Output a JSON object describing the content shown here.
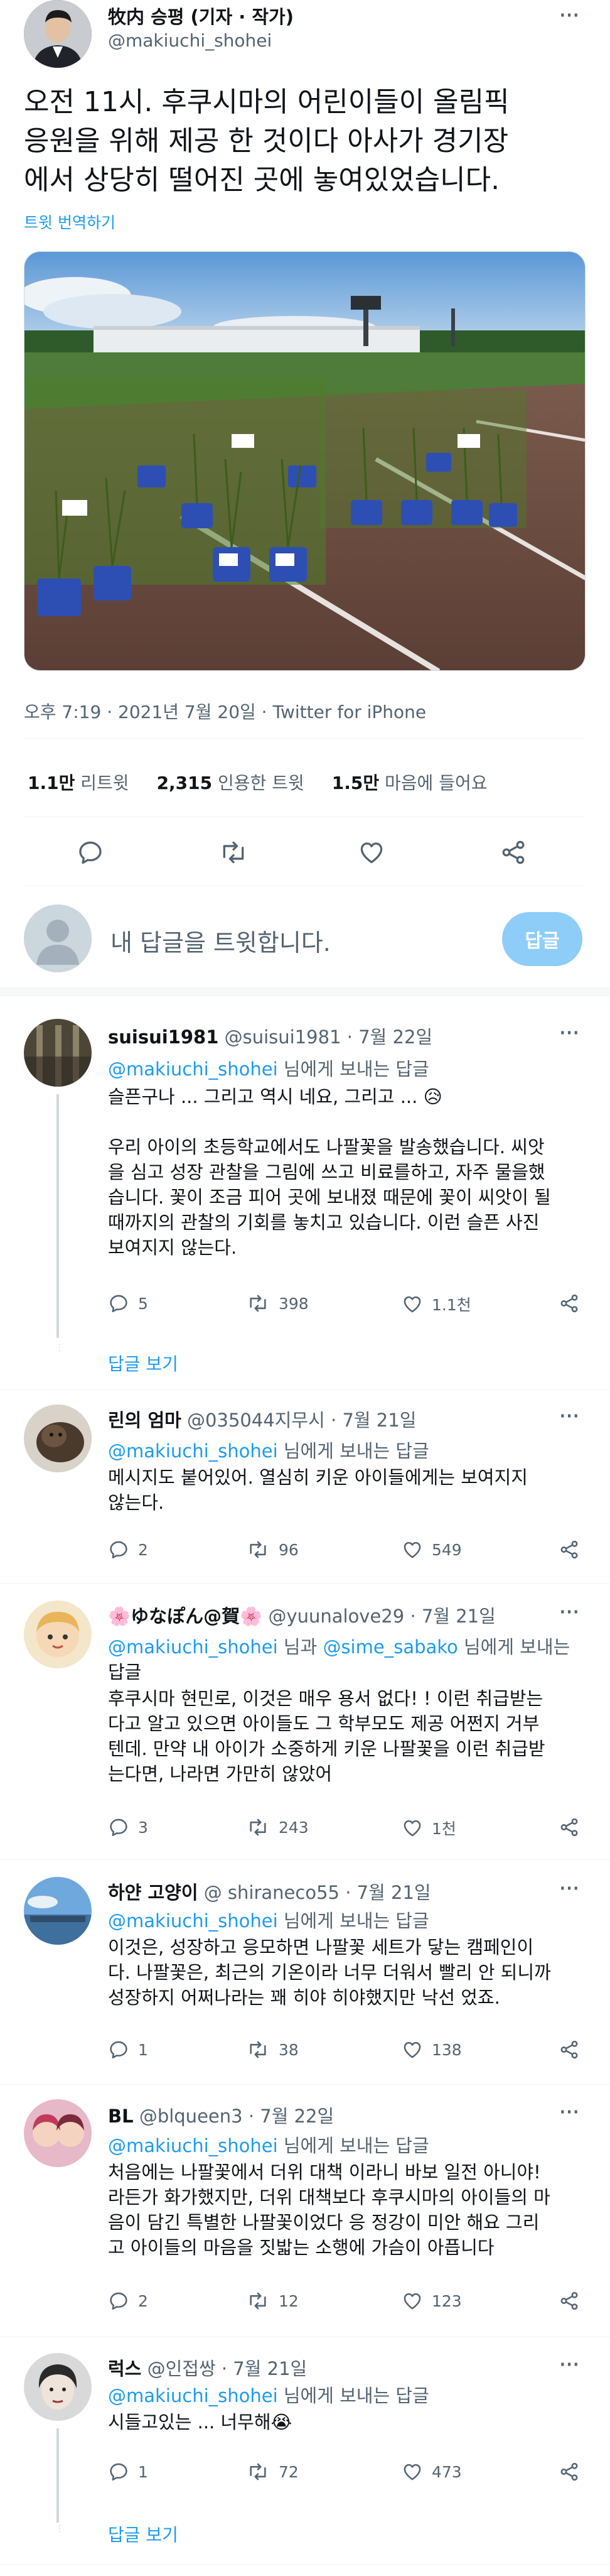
{
  "main_tweet": {
    "author_name": "牧内 승평 (기자 · 작가)",
    "author_handle": "@makiuchi_shohei",
    "text_lines": [
      "오전 11시. 후쿠시마의 어린이들이 올림픽",
      "응원을 위해 제공 한 것이다 아사가 경기장",
      "에서 상당히 떨어진 곳에 놓여있었습니다."
    ],
    "translate_label": "트윗 번역하기",
    "timestamp": "오후 7:19 · 2021년 7월 20일 · Twitter for iPhone",
    "stats": [
      {
        "value": "1.1만",
        "label": "리트윗"
      },
      {
        "value": "2,315",
        "label": "인용한 트윗"
      },
      {
        "value": "1.5만",
        "label": "마음에 들어요"
      }
    ]
  },
  "compose": {
    "placeholder": "내 답글을 트윗합니다.",
    "reply_button": "답글"
  },
  "replies": [
    {
      "name": "suisui1981",
      "handle": "@suisui1981",
      "date": "· 7월 22일",
      "reply_to_handle": "@makiuchi_shohei",
      "reply_to_suffix": " 님에게 보내는 답글",
      "first_line": "슬픈구나 ... 그리고 역시 네요, 그리고 ... 😥",
      "body_lines": [
        "우리 아이의 초등학교에서도 나팔꽃을 발송했습니다. 씨앗",
        "을 심고 성장 관찰을 그림에 쓰고 비료를하고, 자주 물을했",
        "습니다. 꽃이 조금 피어 곳에 보내졌 때문에 꽃이 씨앗이 될",
        "때까지의 관찰의 기회를 놓치고 있습니다. 이런 슬픈 사진",
        "보여지지 않는다."
      ],
      "replies": "5",
      "retweets": "398",
      "likes": "1.1천",
      "show_replies": "답글 보기"
    },
    {
      "name": "린의 엄마",
      "handle": "@035044지무시",
      "date": "· 7월 21일",
      "reply_to_handle": "@makiuchi_shohei",
      "reply_to_suffix": " 님에게 보내는 답글",
      "body_lines": [
        "메시지도 붙어있어. 열심히 키운 아이들에게는 보여지지",
        "않는다."
      ],
      "replies": "2",
      "retweets": "96",
      "likes": "549"
    },
    {
      "name": "🌸ゆなぽん@賀🌸",
      "handle": "@yuunalove29",
      "date": "· 7월 21일",
      "reply_to_handle": "@makiuchi_shohei",
      "reply_to_mid": " 님과 ",
      "reply_to_handle2": "@sime_sabako",
      "reply_to_suffix": " 님에게 보내는",
      "reply_to_line2": "답글",
      "body_lines": [
        "후쿠시마 현민로, 이것은 매우 용서 없다! ! 이런 취급받는",
        "다고 알고 있으면 아이들도 그 학부모도 제공 어쩐지 거부",
        "텐데. 만약 내 아이가 소중하게 키운 나팔꽃을 이런 취급받",
        "는다면, 나라면 가만히 않았어"
      ],
      "replies": "3",
      "retweets": "243",
      "likes": "1천"
    },
    {
      "name": "하얀 고양이",
      "handle": "@ shiraneco55",
      "date": "· 7월 21일",
      "reply_to_handle": "@makiuchi_shohei",
      "reply_to_suffix": " 님에게 보내는 답글",
      "body_lines": [
        "이것은, 성장하고 응모하면 나팔꽃 세트가 닿는 캠페인이",
        "다. 나팔꽃은, 최근의 기온이라 너무 더워서 빨리 안 되니까",
        "성장하지 어쩌나라는 꽤 히야 히야했지만 낙선 었죠."
      ],
      "replies": "1",
      "retweets": "38",
      "likes": "138"
    },
    {
      "name": "BL",
      "handle": "@blqueen3",
      "date": "· 7월 22일",
      "reply_to_handle": "@makiuchi_shohei",
      "reply_to_suffix": " 님에게 보내는 답글",
      "body_lines": [
        "처음에는 나팔꽃에서 더위 대책 이라니 바보 일전 아니야!",
        "라든가 화가했지만, 더위 대책보다 후쿠시마의 아이들의 마",
        "음이 담긴 특별한 나팔꽃이었다 응 정강이 미안 해요 그리",
        "고 아이들의 마음을 짓밟는 소행에 가슴이 아픕니다"
      ],
      "replies": "2",
      "retweets": "12",
      "likes": "123"
    },
    {
      "name": "럭스",
      "handle": "@인접쌍",
      "date": "· 7월 21일",
      "reply_to_handle": "@makiuchi_shohei",
      "reply_to_suffix": " 님에게 보내는 답글",
      "body_lines": [
        "시들고있는 ... 너무해😭"
      ],
      "replies": "1",
      "retweets": "72",
      "likes": "473",
      "show_replies": "답글 보기"
    }
  ],
  "colors": {
    "accent": "#1d9bf0",
    "reply_button_bg": "#8ecdf8",
    "text": "#0f1419",
    "secondary": "#536471"
  }
}
